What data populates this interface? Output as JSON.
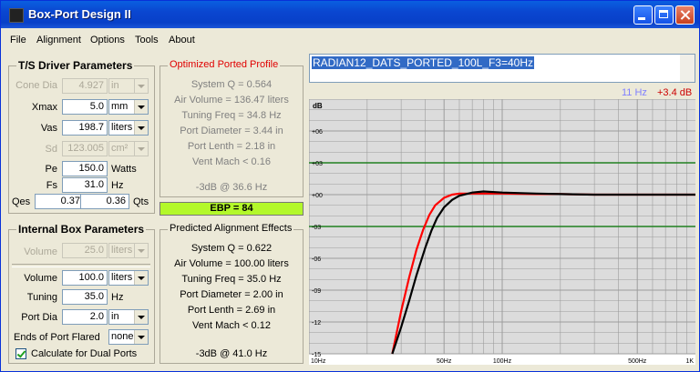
{
  "window": {
    "title": "Box-Port Design II"
  },
  "menu": [
    "File",
    "Alignment",
    "Options",
    "Tools",
    "About"
  ],
  "ts": {
    "caption": "T/S Driver Parameters",
    "cone_dia": {
      "label": "Cone Dia",
      "value": "4.927",
      "unit": "in"
    },
    "xmax": {
      "label": "Xmax",
      "value": "5.0",
      "unit": "mm"
    },
    "vas": {
      "label": "Vas",
      "value": "198.7",
      "unit": "liters"
    },
    "sd": {
      "label": "Sd",
      "value": "123.005",
      "unit": "cm²"
    },
    "pe": {
      "label": "Pe",
      "value": "150.0",
      "unit": "Watts"
    },
    "fs": {
      "label": "Fs",
      "value": "31.0",
      "unit": "Hz"
    },
    "qes": {
      "label": "Qes",
      "value": "0.37"
    },
    "qts": {
      "value": "0.36",
      "label": "Qts"
    }
  },
  "box": {
    "caption": "Internal Box Parameters",
    "volume_dis": {
      "label": "Volume",
      "value": "25.0",
      "unit": "liters"
    },
    "volume": {
      "label": "Volume",
      "value": "100.0",
      "unit": "liters"
    },
    "tuning": {
      "label": "Tuning",
      "value": "35.0",
      "unit": "Hz"
    },
    "port_dia": {
      "label": "Port Dia",
      "value": "2.0",
      "unit": "in"
    },
    "ends": {
      "label": "Ends of Port Flared",
      "value": "none"
    },
    "dual": {
      "label": "Calculate for Dual Ports",
      "checked": true
    }
  },
  "optimized": {
    "caption": "Optimized Ported Profile",
    "lines": [
      "System Q = 0.564",
      "Air Volume = 136.47 liters",
      "Tuning Freq = 34.8 Hz",
      "Port Diameter = 3.44 in",
      "Port Lenth = 2.18 in",
      "Vent Mach < 0.16"
    ],
    "f3": "-3dB @ 36.6 Hz"
  },
  "ebp": "EBP = 84",
  "predicted": {
    "caption": "Predicted Alignment Effects",
    "lines": [
      "System Q = 0.622",
      "Air Volume = 100.00 liters",
      "Tuning Freq = 35.0 Hz",
      "Port Diameter = 2.00 in",
      "Port Lenth = 2.69 in",
      "Vent Mach < 0.12"
    ],
    "f3": "-3dB @ 41.0 Hz"
  },
  "notes": "RADIAN12_DATS_PORTED_100L_F3=40Hz",
  "readout": {
    "freq": "11 Hz",
    "gain": "+3.4 dB",
    "freq_color": "#8080ff",
    "gain_color": "#cc0000"
  },
  "chart_data": {
    "type": "line",
    "ylabel": "dB",
    "y_ticks": [
      "+06",
      "+03",
      "+00",
      "-03",
      "-06",
      "-09",
      "-12",
      "-15"
    ],
    "y_values": [
      6,
      3,
      0,
      -3,
      -6,
      -9,
      -12,
      -15
    ],
    "x_tick_labels": [
      "10Hz",
      "50Hz",
      "100Hz",
      "500Hz",
      "1K"
    ],
    "x_tick_values": [
      10,
      50,
      100,
      500,
      1000
    ],
    "xlim": [
      10,
      1000
    ],
    "ylim": [
      -15,
      9
    ],
    "x_scale": "log",
    "grid": true,
    "green_lines": [
      3,
      -3
    ],
    "colors": {
      "plot_bg": "#dcdcdc",
      "grid": "#9c9c9c",
      "green": "#208020",
      "optimized": "#ff0000",
      "predicted": "#000000"
    },
    "series": [
      {
        "x": [
          27,
          30,
          33,
          36,
          39,
          42,
          45,
          50,
          55,
          60,
          70,
          80,
          100,
          150,
          200,
          300,
          500,
          1000
        ],
        "y": [
          -15,
          -11,
          -7.8,
          -5.2,
          -3.3,
          -1.9,
          -1.0,
          -0.3,
          0,
          0.1,
          0.1,
          0.1,
          0.1,
          0.05,
          0.05,
          0,
          0,
          0
        ]
      },
      {
        "x": [
          27,
          30,
          33,
          36,
          40,
          43,
          46,
          50,
          55,
          60,
          70,
          80,
          100,
          150,
          200,
          300,
          500,
          1000
        ],
        "y": [
          -15,
          -12.5,
          -10,
          -7.6,
          -5.0,
          -3.4,
          -2.2,
          -1.2,
          -0.5,
          -0.1,
          0.2,
          0.3,
          0.2,
          0.1,
          0.05,
          0,
          0,
          0
        ]
      }
    ]
  }
}
